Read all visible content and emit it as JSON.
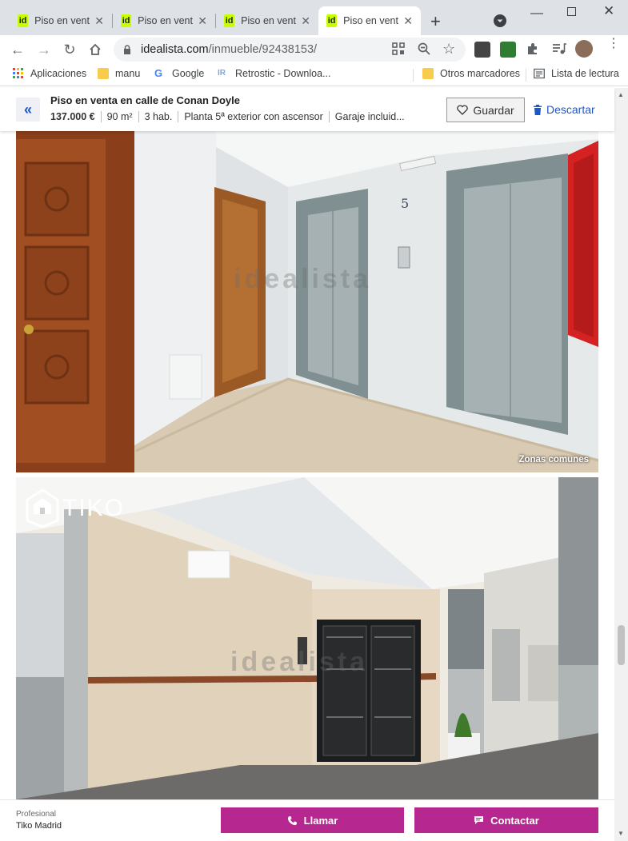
{
  "browser": {
    "tabs": [
      {
        "label": "Piso en venta",
        "favicon": "id",
        "active": false
      },
      {
        "label": "Piso en venta",
        "favicon": "id",
        "active": false
      },
      {
        "label": "Piso en venta",
        "favicon": "id",
        "active": false
      },
      {
        "label": "Piso en venta",
        "favicon": "id",
        "active": true
      }
    ],
    "new_tab_label": "+",
    "url_domain": "idealista.com",
    "url_path": "/inmueble/92438153/",
    "bookmarks": [
      {
        "label": "Aplicaciones",
        "icon": "apps-grid-icon"
      },
      {
        "label": "manu",
        "icon": "folder-icon"
      },
      {
        "label": "Google",
        "icon": "google-icon"
      },
      {
        "label": "Retrostic - Downloa...",
        "icon": "retrostic-icon"
      }
    ],
    "other_bookmarks": "Otros marcadores",
    "reading_list": "Lista de lectura"
  },
  "listing": {
    "title": "Piso en venta en calle de Conan Doyle",
    "price": "137.000 €",
    "area": "90 m²",
    "rooms": "3 hab.",
    "floor": "Planta 5ª exterior con ascensor",
    "garage": "Garaje incluid...",
    "save_label": "Guardar",
    "discard_label": "Descartar"
  },
  "photos": [
    {
      "caption": "Zonas comunes",
      "watermark": "idealista",
      "floor_sign": "5"
    },
    {
      "logo": "TIKO",
      "watermark": "idealista"
    }
  ],
  "contact": {
    "type_label": "Profesional",
    "agency": "Tiko Madrid",
    "call_label": "Llamar",
    "contact_label": "Contactar"
  },
  "colors": {
    "accent": "#b72790",
    "link": "#1a57c9",
    "favicon": "#c8ff00"
  }
}
